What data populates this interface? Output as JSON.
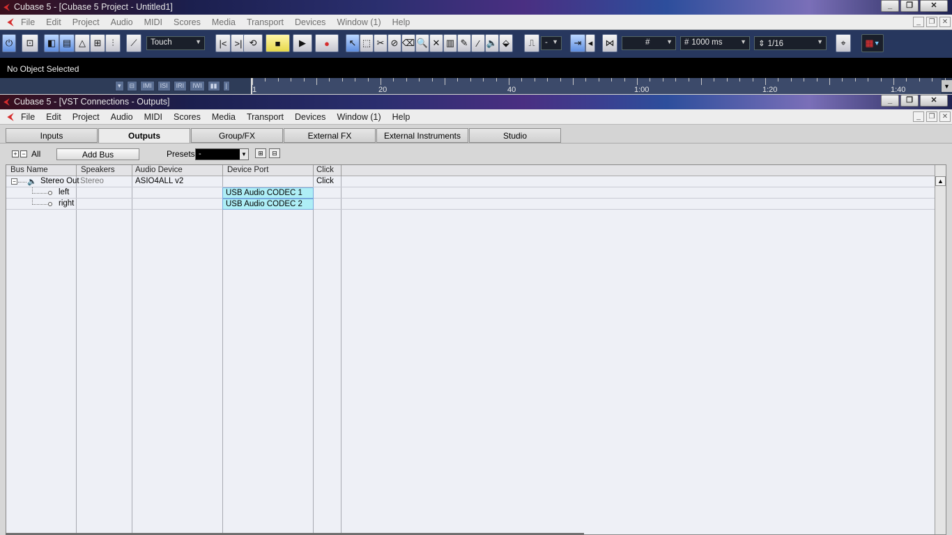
{
  "project_window": {
    "title": "Cubase 5 - [Cubase 5 Project - Untitled1]",
    "menu": [
      "File",
      "Edit",
      "Project",
      "Audio",
      "MIDI",
      "Scores",
      "Media",
      "Transport",
      "Devices",
      "Window (1)",
      "Help"
    ],
    "toolbar": {
      "automation_mode": "Touch",
      "quantize_dropdown": "-",
      "snap_time": "1000 ms",
      "quantize_value": "1/16"
    },
    "info_line": "No Object Selected",
    "ruler_labels": [
      "1",
      "20",
      "40",
      "1:00",
      "1:20",
      "1:40"
    ]
  },
  "vst_window": {
    "title": "Cubase 5 - [VST Connections - Outputs]",
    "menu": [
      "File",
      "Edit",
      "Project",
      "Audio",
      "MIDI",
      "Scores",
      "Media",
      "Transport",
      "Devices",
      "Window (1)",
      "Help"
    ],
    "tabs": [
      "Inputs",
      "Outputs",
      "Group/FX",
      "External FX",
      "External Instruments",
      "Studio"
    ],
    "active_tab": "Outputs",
    "controls": {
      "all_label": "All",
      "add_bus_label": "Add Bus",
      "presets_label": "Presets",
      "presets_value": "-"
    },
    "table": {
      "headers": [
        "Bus Name",
        "Speakers",
        "Audio Device",
        "Device Port",
        "Click"
      ],
      "rows": [
        {
          "bus": "Stereo Out",
          "speakers": "Stereo",
          "device": "ASIO4ALL v2",
          "port": "",
          "click": "Click"
        },
        {
          "bus": "left",
          "speakers": "",
          "device": "",
          "port": "USB Audio CODEC  1",
          "click": ""
        },
        {
          "bus": "right",
          "speakers": "",
          "device": "",
          "port": "USB Audio CODEC  2",
          "click": ""
        }
      ]
    }
  },
  "colors": {
    "port_highlight": "#aeeef6",
    "toolbar_bg": "#27375e",
    "accent_red": "#d62d2d"
  }
}
